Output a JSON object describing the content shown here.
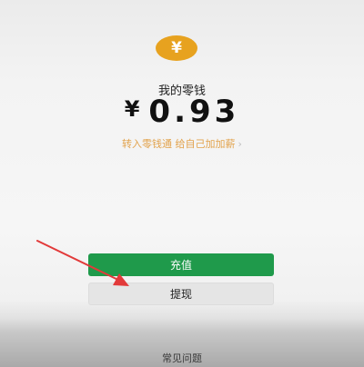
{
  "wallet": {
    "coin_symbol": "¥",
    "title": "我的零钱",
    "currency_symbol": "¥",
    "balance": "0.93",
    "transfer_link": "转入零钱通 给自己加加薪",
    "transfer_chevron": "›"
  },
  "actions": {
    "recharge_label": "充值",
    "withdraw_label": "提现"
  },
  "footer": {
    "faq_label": "常见问题"
  },
  "colors": {
    "coin": "#e7a21f",
    "accent_orange": "#e2a24b",
    "primary_green": "#1f9a4b",
    "annotation_arrow": "#e23a3a"
  }
}
